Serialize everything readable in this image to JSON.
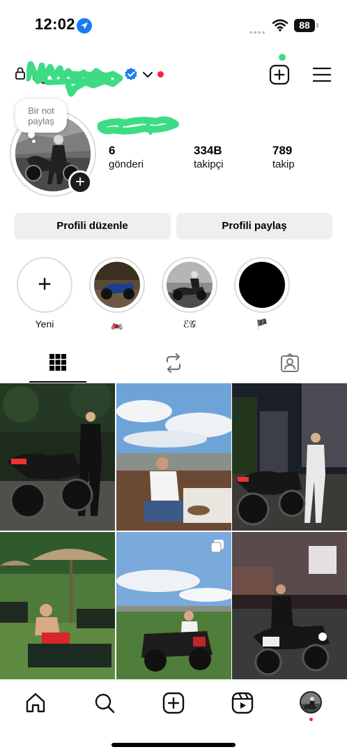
{
  "status_bar": {
    "time": "12:02",
    "battery": "88",
    "signal": "••••"
  },
  "header": {
    "username": "eg",
    "username_redacted": true,
    "verified": true,
    "icons": {
      "lock": "lock-icon",
      "verified": "verified-badge-icon",
      "chevron": "chevron-down-icon",
      "new_post": "new-post-icon",
      "menu": "hamburger-menu-icon"
    }
  },
  "note": {
    "line1": "Bir not",
    "line2": "paylaş"
  },
  "profile": {
    "display_name_redacted": true,
    "stats": {
      "posts_count": "6",
      "posts_label": "gönderi",
      "followers_count": "334B",
      "followers_label": "takipçi",
      "following_count": "789",
      "following_label": "takip"
    }
  },
  "actions": {
    "edit_label": "Profili düzenle",
    "share_label": "Profili paylaş"
  },
  "highlights": [
    {
      "label": "Yeni",
      "type": "new"
    },
    {
      "label": "🏍️",
      "type": "story"
    },
    {
      "label": "ℰ𝒢",
      "type": "story"
    },
    {
      "label": "🏴",
      "type": "story"
    }
  ],
  "tabs": [
    {
      "name": "posts-grid-icon",
      "active": true
    },
    {
      "name": "reposts-icon",
      "active": false
    },
    {
      "name": "tagged-icon",
      "active": false
    }
  ],
  "posts": [
    {
      "description": "motorcycle-night-photo"
    },
    {
      "description": "rooftop-restaurant-photo"
    },
    {
      "description": "motorcycle-city-night-photo"
    },
    {
      "description": "poolside-photo"
    },
    {
      "description": "atv-field-photo",
      "multiple": true
    },
    {
      "description": "motorcycle-street-night-photo"
    }
  ],
  "bottom_nav": [
    {
      "name": "home-icon"
    },
    {
      "name": "search-icon"
    },
    {
      "name": "create-icon"
    },
    {
      "name": "reels-icon"
    },
    {
      "name": "profile-avatar"
    }
  ],
  "colors": {
    "accent_blue": "#1a7cf5",
    "notification_red": "#ff1f3d",
    "scribble_green": "#3ddc84",
    "button_bg": "#efefef"
  }
}
